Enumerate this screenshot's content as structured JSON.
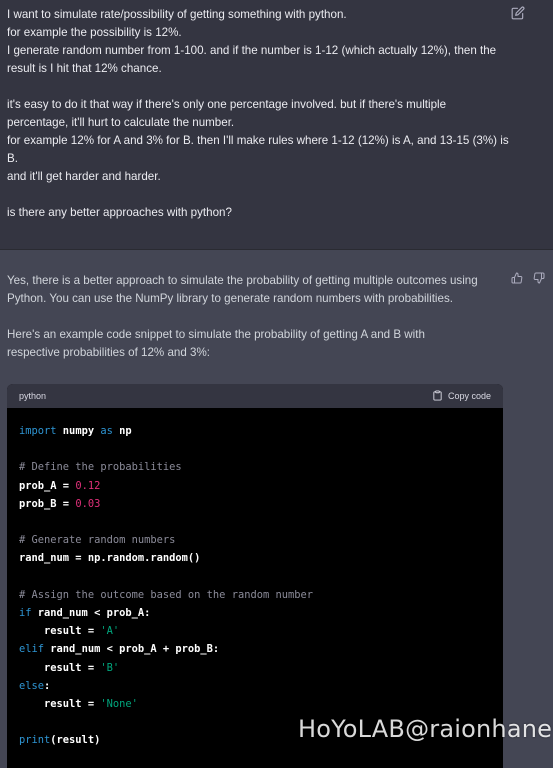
{
  "user_message": {
    "lines": [
      "I want to simulate rate/possibility of getting something with python.",
      "for example the possibility is 12%.",
      "I generate random number from 1-100. and if the number is 1-12 (which actually 12%), then the",
      "result is I hit that 12% chance.",
      "",
      "it's easy to do it that way if there's only one percentage involved. but if there's multiple",
      "percentage, it'll hurt to calculate the number.",
      "for example 12% for A and 3% for B. then I'll make rules where 1-12 (12%) is A, and 13-15 (3%) is",
      "B.",
      "and it'll get harder and harder.",
      "",
      "is there any better approaches with python?"
    ]
  },
  "assistant_message": {
    "paragraph1_line1": "Yes, there is a better approach to simulate the probability of getting multiple outcomes using",
    "paragraph1_line2": "Python. You can use the NumPy library to generate random numbers with probabilities.",
    "paragraph2_line1": "Here's an example code snippet to simulate the probability of getting A and B with",
    "paragraph2_line2": "respective probabilities of 12% and 3%:"
  },
  "code_block": {
    "language": "python",
    "copy_label": "Copy code",
    "lines": [
      [
        {
          "t": "import",
          "c": "kw"
        },
        {
          "t": " numpy ",
          "c": "bold"
        },
        {
          "t": "as",
          "c": "kw"
        },
        {
          "t": " np",
          "c": "bold"
        }
      ],
      [],
      [
        {
          "t": "# Define the probabilities",
          "c": "cm"
        }
      ],
      [
        {
          "t": "prob_A = ",
          "c": "bold"
        },
        {
          "t": "0.12",
          "c": "num"
        }
      ],
      [
        {
          "t": "prob_B = ",
          "c": "bold"
        },
        {
          "t": "0.03",
          "c": "num"
        }
      ],
      [],
      [
        {
          "t": "# Generate random numbers",
          "c": "cm"
        }
      ],
      [
        {
          "t": "rand_num = np.random.random()",
          "c": "bold"
        }
      ],
      [],
      [
        {
          "t": "# Assign the outcome based on the random number",
          "c": "cm"
        }
      ],
      [
        {
          "t": "if",
          "c": "kw"
        },
        {
          "t": " rand_num < prob_A:",
          "c": "bold"
        }
      ],
      [
        {
          "t": "    result = ",
          "c": "bold"
        },
        {
          "t": "'A'",
          "c": "str"
        }
      ],
      [
        {
          "t": "elif",
          "c": "kw"
        },
        {
          "t": " rand_num < prob_A + prob_B:",
          "c": "bold"
        }
      ],
      [
        {
          "t": "    result = ",
          "c": "bold"
        },
        {
          "t": "'B'",
          "c": "str"
        }
      ],
      [
        {
          "t": "else",
          "c": "kw"
        },
        {
          "t": ":",
          "c": "bold"
        }
      ],
      [
        {
          "t": "    result = ",
          "c": "bold"
        },
        {
          "t": "'None'",
          "c": "str"
        }
      ],
      [],
      [
        {
          "t": "print",
          "c": "kw"
        },
        {
          "t": "(result)",
          "c": "bold"
        }
      ]
    ]
  },
  "watermark": "HoYoLAB@raionhane",
  "icons": {
    "edit": "edit-icon",
    "thumbs_up": "thumbs-up-icon",
    "thumbs_down": "thumbs-down-icon",
    "copy": "clipboard-icon"
  },
  "colors": {
    "user_bg": "#343541",
    "assistant_bg": "#444654",
    "code_bg": "#000000",
    "keyword": "#2e95d3",
    "comment": "#8b8b99",
    "number": "#df3079",
    "string": "#00a67d"
  }
}
